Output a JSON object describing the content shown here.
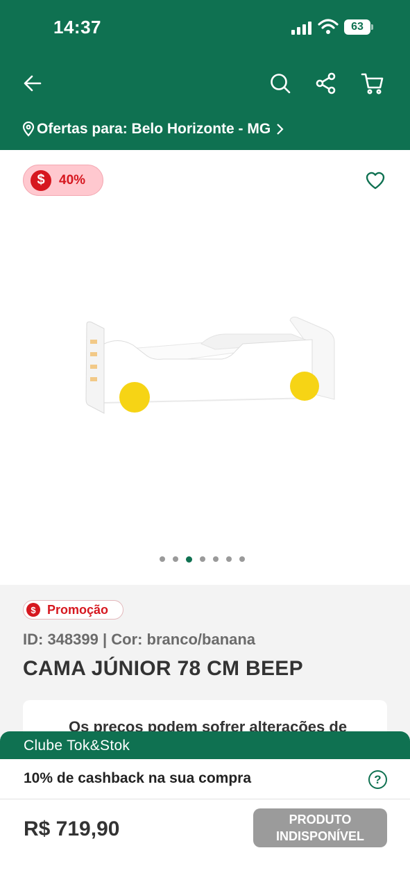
{
  "status_bar": {
    "time": "14:37",
    "battery": "63"
  },
  "header": {
    "location_label": "Ofertas para: Belo Horizonte - MG"
  },
  "product_gallery": {
    "discount": "40%",
    "dot_count": 7,
    "active_dot": 2
  },
  "product": {
    "promo_label": "Promoção",
    "meta": "ID: 348399 | Cor: branco/banana",
    "title": "CAMA JÚNIOR 78 CM BEEP",
    "notice": "Os preços podem sofrer alterações de"
  },
  "club": {
    "title": "Clube Tok&Stok",
    "cashback": "10% de cashback na sua compra"
  },
  "purchase": {
    "price": "R$ 719,90",
    "button_line1": "PRODUTO",
    "button_line2": "INDISPONÍVEL"
  },
  "colors": {
    "brand_green": "#0f7151",
    "promo_red": "#d6171f",
    "badge_pink": "#ffc8cf",
    "disabled_gray": "#9b9b9b"
  }
}
